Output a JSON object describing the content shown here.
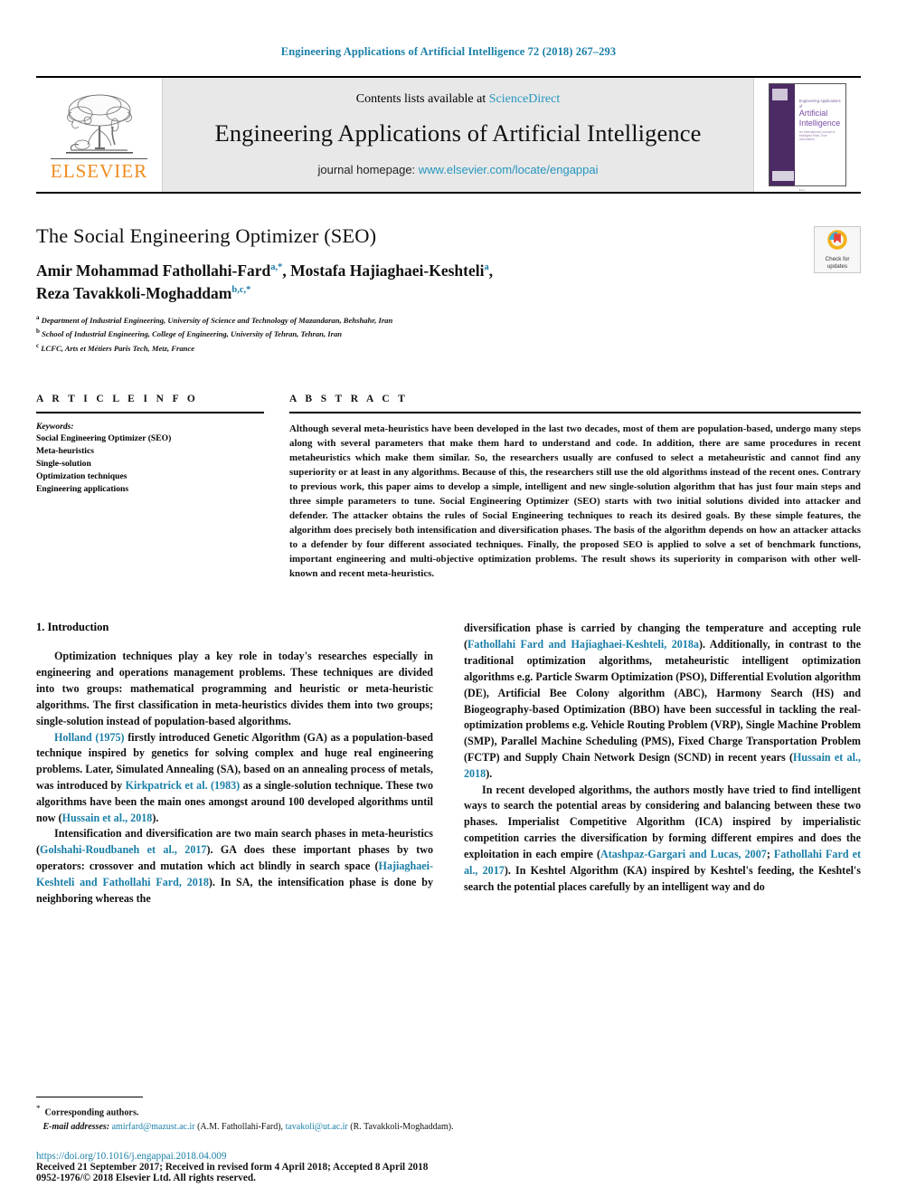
{
  "running_head": "Engineering Applications of Artificial Intelligence 72 (2018) 267–293",
  "masthead": {
    "publisher_name": "ELSEVIER",
    "contents_prefix": "Contents lists available at ",
    "contents_link": "ScienceDirect",
    "journal_name": "Engineering Applications of Artificial Intelligence",
    "homepage_prefix": "journal homepage: ",
    "homepage_url": "www.elsevier.com/locate/engappai",
    "cover": {
      "line1": "Engineering Applications of",
      "line2": "Artificial",
      "line3": "Intelligence",
      "line4": "An International Journal of Intelligent Real-Time Automation",
      "badge_label": "IFAC"
    }
  },
  "article": {
    "title": "The Social Engineering Optimizer (SEO)",
    "authors_line1": "Amir Mohammad Fathollahi-Fard",
    "authors_line1_sup": "a,",
    "authors_line1_mid": ", Mostafa Hajiaghaei-Keshteli",
    "authors_line1_sup2": "a",
    "authors_line2": "Reza Tavakkoli-Moghaddam",
    "authors_line2_sup": "b,c,",
    "affiliations": [
      {
        "marker": "a",
        "text": "Department of Industrial Engineering, University of Science and Technology of Mazandaran, Behshahr, Iran"
      },
      {
        "marker": "b",
        "text": "School of Industrial Engineering, College of Engineering, University of Tehran, Tehran, Iran"
      },
      {
        "marker": "c",
        "text": "LCFC, Arts et Métiers Paris Tech, Metz, France"
      }
    ],
    "crossmark_label_line1": "Check for",
    "crossmark_label_line2": "updates"
  },
  "article_info": {
    "heading": "A R T I C L E   I N F O",
    "keywords_title": "Keywords:",
    "keywords": [
      "Social Engineering Optimizer (SEO)",
      "Meta-heuristics",
      "Single-solution",
      "Optimization techniques",
      "Engineering applications"
    ]
  },
  "abstract": {
    "heading": "A B S T R A C T",
    "text": "Although several meta-heuristics have been developed in the last two decades, most of them are population-based, undergo many steps along with  several parameters that make them hard to understand and code. In addition, there are same procedures in recent metaheuristics which make them similar. So, the researchers usually are confused to select a metaheuristic and cannot find any superiority or at least in any algorithms. Because of this, the researchers still use the old algorithms instead of the recent ones. Contrary to previous work, this paper aims to develop a simple, intelligent and new single-solution algorithm that has just four main steps and three simple parameters to tune. Social Engineering Optimizer (SEO) starts with two initial solutions divided into attacker and defender. The attacker obtains the rules of Social Engineering techniques to reach its desired goals. By these simple features, the algorithm does precisely both intensification and diversification phases. The basis of the algorithm depends on how an attacker attacks to a defender by four different associated techniques. Finally, the proposed SEO is applied to solve a set of benchmark functions, important engineering and multi-objective optimization problems. The result shows its superiority in comparison with other well-known and recent meta-heuristics."
  },
  "introduction": {
    "section_title": "1.  Introduction",
    "left_paragraphs": [
      "Optimization techniques play a key role in today's researches especially in engineering and operations management problems. These techniques are divided into two groups: mathematical programming and heuristic or meta-heuristic algorithms. The first classification in meta-heuristics divides them into two groups; single-solution instead of population-based algorithms."
    ],
    "left_p2_pre": "",
    "left_p2_ref1": "Holland (1975)",
    "left_p2_mid1": " firstly introduced Genetic Algorithm (GA) as a population-based technique inspired by genetics for solving complex and huge real engineering problems. Later, Simulated Annealing (SA), based on an annealing process of metals, was introduced by ",
    "left_p2_ref2": "Kirkpatrick et al. (1983)",
    "left_p2_mid2": " as a single-solution technique. These two algorithms have been the main ones amongst around 100 developed algorithms until now (",
    "left_p2_ref3": "Hussain et al., 2018",
    "left_p2_end": ").",
    "left_p3_pre": "Intensification and diversification are two main search phases in meta-heuristics (",
    "left_p3_ref1": "Golshahi-Roudbaneh et al., 2017",
    "left_p3_mid1": "). GA does these important phases by two operators: crossover and mutation which act blindly in search space (",
    "left_p3_ref2": "Hajiaghaei-Keshteli and Fathollahi Fard, 2018",
    "left_p3_end": "). In SA, the intensification phase is done by neighboring whereas the",
    "right_p1_pre": "diversification phase is carried by changing the temperature and accepting rule (",
    "right_p1_ref1": "Fathollahi Fard and Hajiaghaei-Keshteli, 2018a",
    "right_p1_mid1": "). Additionally, in contrast to the traditional optimization algorithms, metaheuristic intelligent optimization algorithms e.g. Particle Swarm Optimization (PSO), Differential Evolution algorithm (DE), Artificial Bee Colony algorithm (ABC), Harmony Search (HS) and Biogeography-based Optimization (BBO) have been successful in tackling the real-optimization problems e.g. Vehicle Routing Problem (VRP), Single Machine Problem (SMP), Parallel Machine Scheduling (PMS), Fixed Charge Transportation Problem (FCTP) and Supply Chain Network Design (SCND) in recent years (",
    "right_p1_ref2": "Hussain et al., 2018",
    "right_p1_end": ").",
    "right_p2_pre": "In recent developed algorithms, the authors mostly have tried to find intelligent ways to search the potential areas by considering and balancing between these two phases. Imperialist Competitive Algorithm (ICA) inspired by imperialistic competition carries the diversification by forming different empires and does the exploitation in each empire (",
    "right_p2_ref1": "Atashpaz-Gargari and Lucas, 2007",
    "right_p2_sep": "; ",
    "right_p2_ref2": "Fathollahi Fard et al., 2017",
    "right_p2_end": "). In Keshtel Algorithm (KA) inspired by Keshtel's feeding, the Keshtel's search the potential places carefully by an intelligent way and do"
  },
  "footnotes": {
    "corresponding": "Corresponding authors.",
    "email_label": "E-mail addresses:",
    "email1": "amirfard@mazust.ac.ir",
    "email1_name": " (A.M. Fathollahi-Fard), ",
    "email2": "tavakoli@ut.ac.ir",
    "email2_name": " (R. Tavakkoli-Moghaddam).",
    "doi": "https://doi.org/10.1016/j.engappai.2018.04.009",
    "received": "Received 21 September 2017; Received in revised form 4 April 2018; Accepted 8 April 2018",
    "issn": "0952-1976/© 2018 Elsevier Ltd. All rights reserved."
  },
  "colors": {
    "link": "#1a7fa8",
    "elsevier_orange": "#f08a1e",
    "masthead_gray": "#e8e8e8",
    "cover_purple": "#4c2a63"
  }
}
